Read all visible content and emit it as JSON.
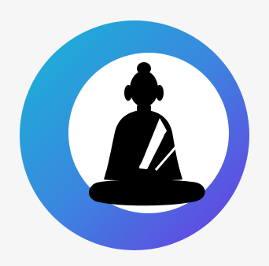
{
  "app_icon": {
    "icon_name": "meditating-buddha-icon",
    "colors": {
      "background": "#f6f6f6",
      "ring_gradient_start": "#1ea8d6",
      "ring_gradient_mid": "#3f7ee0",
      "ring_gradient_end": "#6a3de2",
      "inner_circle": "#ffffff",
      "figure": "#000000"
    }
  }
}
